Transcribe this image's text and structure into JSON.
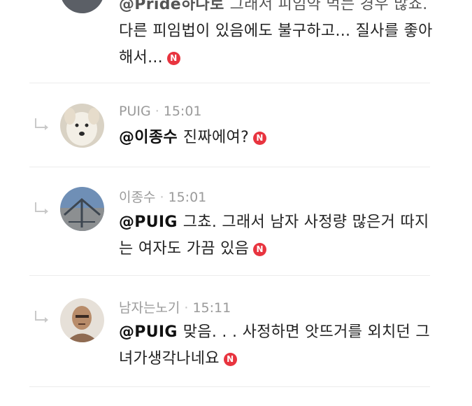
{
  "comments": [
    {
      "mention": "@Pride하나로",
      "text_line1": "그래서 피임약 먹는 경우 많죠.",
      "text_line2": "다른 피임법이 있음에도 불구하고... 질사를 좋아",
      "text_line3": "해서...",
      "badge": "N"
    },
    {
      "author": "PUIG",
      "time": "15:01",
      "mention": "@이종수",
      "text_line1": "진짜에여?",
      "badge": "N",
      "avatar_icon": "dog-avatar-icon"
    },
    {
      "author": "이종수",
      "time": "15:01",
      "mention": "@PUIG",
      "text_line1": "그쵸. 그래서 남자 사정량 많은거 따지",
      "text_line2": "는 여자도 가끔 있음",
      "badge": "N",
      "avatar_icon": "landscape-avatar-icon"
    },
    {
      "author": "남자는노기",
      "time": "15:11",
      "mention": "@PUIG",
      "text_line1": "맞음. . . 사정하면 앗뜨거를 외치던 그",
      "text_line2": "녀가생각나네요",
      "badge": "N",
      "avatar_icon": "man-avatar-icon"
    }
  ],
  "colors": {
    "badge": "#e8343f",
    "meta": "#9a9a9a",
    "divider": "#ececec"
  }
}
